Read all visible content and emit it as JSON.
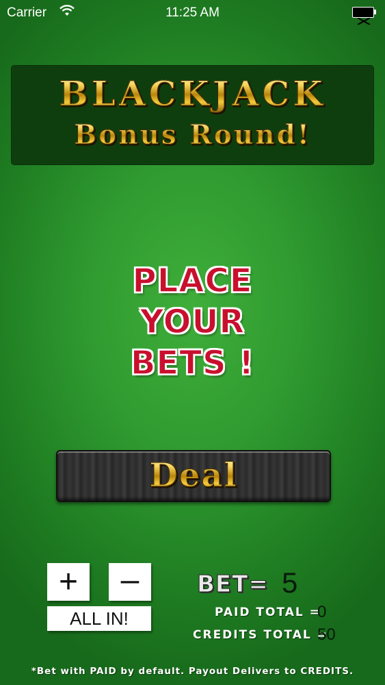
{
  "status_bar": {
    "carrier": "Carrier",
    "time": "11:25 AM"
  },
  "title": {
    "line1": "BLACKJACK",
    "line2": "Bonus Round!"
  },
  "prompt": {
    "line1": "PLACE",
    "line2": "YOUR",
    "line3": "BETS !"
  },
  "deal_button": {
    "label": "Deal"
  },
  "controls": {
    "plus_label": "+",
    "minus_label": "–",
    "all_in_label": "ALL IN!"
  },
  "bet": {
    "label": "BET=",
    "value": "5"
  },
  "totals": {
    "paid_label": "PAID TOTAL =",
    "paid_value": "0",
    "credits_label": "CREDITS TOTAL =",
    "credits_value": "50"
  },
  "footer": {
    "note": "*Bet with PAID by default. Payout Delivers to CREDITS."
  },
  "colors": {
    "felt": "#2f9a30",
    "panel": "#0e3e0e",
    "prompt_red": "#c8102e",
    "gold": "#f6d55c"
  }
}
